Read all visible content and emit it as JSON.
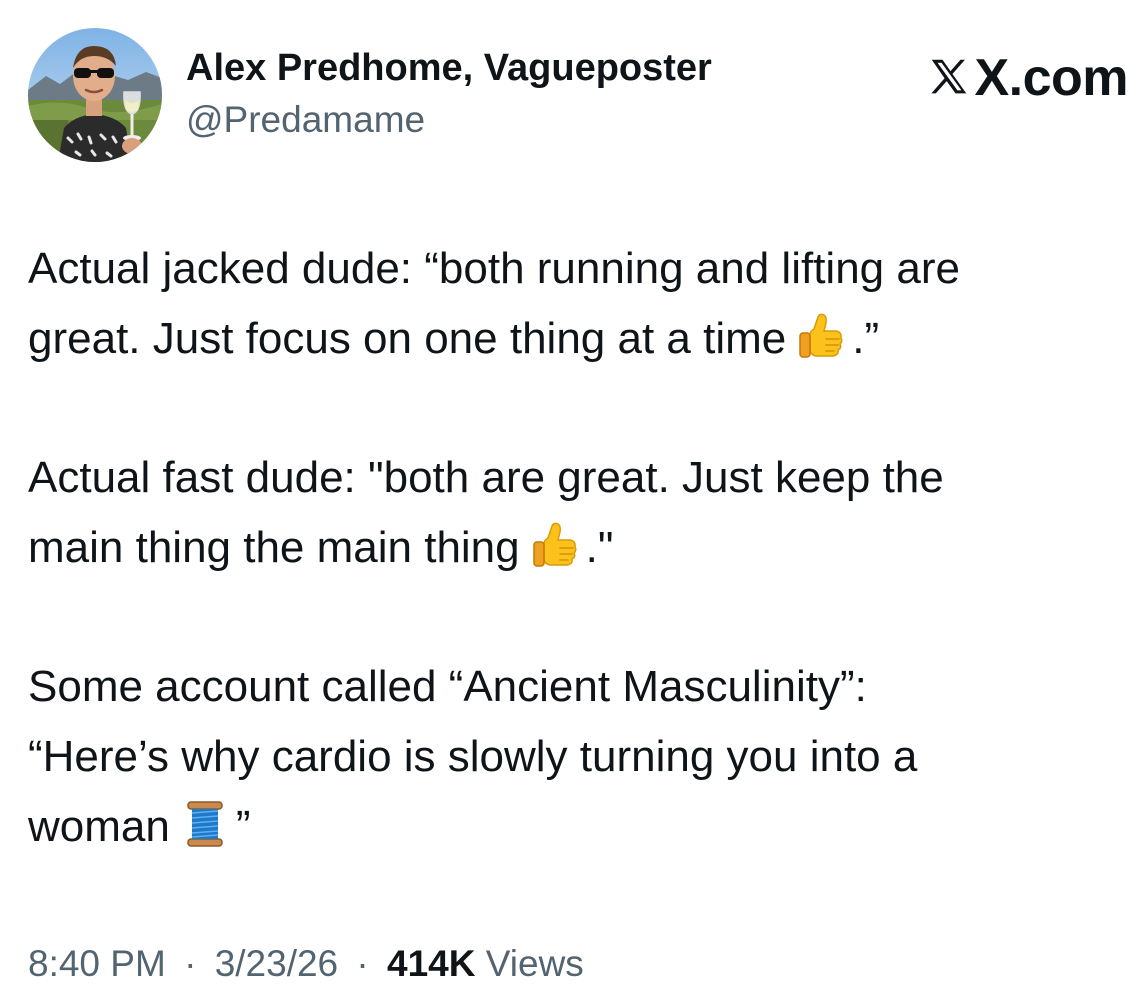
{
  "author": {
    "display_name": "Alex Predhome, Vagueposter",
    "handle": "@Predamame",
    "avatar_icon": "profile-photo"
  },
  "brand": {
    "label": "X.com",
    "icon": "x-logo-icon"
  },
  "post": {
    "paragraphs": [
      {
        "line1": "Actual jacked dude: “both running and lifting are",
        "line2_before": "great. Just focus on one thing at a time",
        "emoji": "thumbs-up-icon",
        "line2_after": ".”"
      },
      {
        "line1": "Actual fast dude: \"both are great. Just keep the",
        "line2_before": "main thing the main thing",
        "emoji": "thumbs-up-icon",
        "line2_after": ".\""
      },
      {
        "line1": "Some account called “Ancient Masculinity”:",
        "line2": "“Here’s why cardio is slowly turning you into a",
        "line3_before": "woman",
        "emoji": "spool-of-thread-icon",
        "line3_after": "”"
      }
    ]
  },
  "meta": {
    "time": "8:40 PM",
    "separator": "·",
    "date": "3/23/26",
    "views_count": "414K",
    "views_label": "Views"
  },
  "colors": {
    "text_primary": "#0f1419",
    "text_secondary": "#536471",
    "background": "#ffffff"
  }
}
